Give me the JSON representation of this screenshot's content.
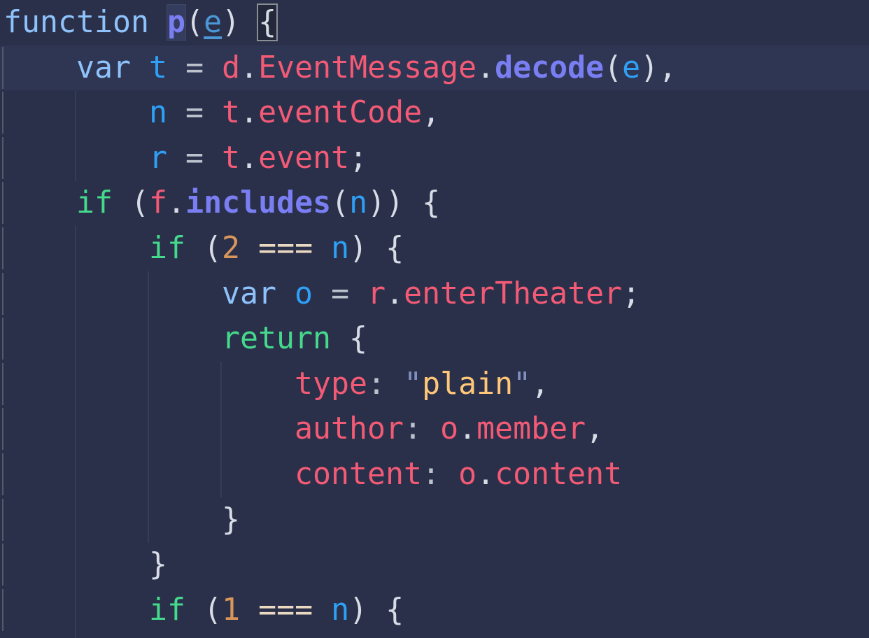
{
  "editor": {
    "colors": {
      "background": "#2a304a",
      "current_line": "#2f3653",
      "keyword": "#8ec2fb",
      "function": "#7a7ef3",
      "variable": "#2ea0f6",
      "property": "#f25a75",
      "control": "#45d98c",
      "number": "#d9965a",
      "string": "#ffc777"
    },
    "current_line_index": 1,
    "lines": [
      [
        [
          "function",
          "kw"
        ],
        [
          " ",
          "punc"
        ],
        [
          "p",
          "fn hl-p"
        ],
        [
          "(",
          "punc"
        ],
        [
          "e",
          "param"
        ],
        [
          ")",
          "punc"
        ],
        [
          " ",
          "punc"
        ],
        [
          "{",
          "punc hl-brace"
        ]
      ],
      [
        [
          "    ",
          "punc"
        ],
        [
          "var",
          "kw"
        ],
        [
          " ",
          "punc"
        ],
        [
          "t",
          "var"
        ],
        [
          " = ",
          "op"
        ],
        [
          "d",
          "prop"
        ],
        [
          ".",
          "punc"
        ],
        [
          "EventMessage",
          "prop"
        ],
        [
          ".",
          "punc"
        ],
        [
          "decode",
          "fn"
        ],
        [
          "(",
          "punc"
        ],
        [
          "e",
          "var"
        ],
        [
          "),",
          "punc"
        ]
      ],
      [
        [
          "        ",
          "punc"
        ],
        [
          "n",
          "var"
        ],
        [
          " = ",
          "op"
        ],
        [
          "t",
          "prop"
        ],
        [
          ".",
          "punc"
        ],
        [
          "eventCode",
          "prop"
        ],
        [
          ",",
          "punc"
        ]
      ],
      [
        [
          "        ",
          "punc"
        ],
        [
          "r",
          "var"
        ],
        [
          " = ",
          "op"
        ],
        [
          "t",
          "prop"
        ],
        [
          ".",
          "punc"
        ],
        [
          "event",
          "prop"
        ],
        [
          ";",
          "punc"
        ]
      ],
      [
        [
          "    ",
          "punc"
        ],
        [
          "if",
          "ctrl"
        ],
        [
          " (",
          "punc"
        ],
        [
          "f",
          "prop"
        ],
        [
          ".",
          "punc"
        ],
        [
          "includes",
          "fn"
        ],
        [
          "(",
          "punc"
        ],
        [
          "n",
          "var"
        ],
        [
          ")) {",
          "punc"
        ]
      ],
      [
        [
          "        ",
          "punc"
        ],
        [
          "if",
          "ctrl"
        ],
        [
          " (",
          "punc"
        ],
        [
          "2",
          "num"
        ],
        [
          " ",
          "punc"
        ],
        [
          "===",
          "cmp"
        ],
        [
          " ",
          "punc"
        ],
        [
          "n",
          "var"
        ],
        [
          ") {",
          "punc"
        ]
      ],
      [
        [
          "            ",
          "punc"
        ],
        [
          "var",
          "kw"
        ],
        [
          " ",
          "punc"
        ],
        [
          "o",
          "var"
        ],
        [
          " = ",
          "op"
        ],
        [
          "r",
          "prop"
        ],
        [
          ".",
          "punc"
        ],
        [
          "enterTheater",
          "prop"
        ],
        [
          ";",
          "punc"
        ]
      ],
      [
        [
          "            ",
          "punc"
        ],
        [
          "return",
          "ctrl"
        ],
        [
          " {",
          "punc"
        ]
      ],
      [
        [
          "                ",
          "punc"
        ],
        [
          "type",
          "prop"
        ],
        [
          ": ",
          "op"
        ],
        [
          "\"",
          "quote"
        ],
        [
          "plain",
          "str"
        ],
        [
          "\"",
          "quote"
        ],
        [
          ",",
          "punc"
        ]
      ],
      [
        [
          "                ",
          "punc"
        ],
        [
          "author",
          "prop"
        ],
        [
          ": ",
          "op"
        ],
        [
          "o",
          "prop"
        ],
        [
          ".",
          "punc"
        ],
        [
          "member",
          "prop"
        ],
        [
          ",",
          "punc"
        ]
      ],
      [
        [
          "                ",
          "punc"
        ],
        [
          "content",
          "prop"
        ],
        [
          ": ",
          "op"
        ],
        [
          "o",
          "prop"
        ],
        [
          ".",
          "punc"
        ],
        [
          "content",
          "prop"
        ]
      ],
      [
        [
          "            ",
          "punc"
        ],
        [
          "}",
          "punc"
        ]
      ],
      [
        [
          "        ",
          "punc"
        ],
        [
          "}",
          "punc"
        ]
      ],
      [
        [
          "        ",
          "punc"
        ],
        [
          "if",
          "ctrl"
        ],
        [
          " (",
          "punc"
        ],
        [
          "1",
          "num"
        ],
        [
          " ",
          "punc"
        ],
        [
          "===",
          "cmp"
        ],
        [
          " ",
          "punc"
        ],
        [
          "n",
          "var"
        ],
        [
          ") {",
          "punc"
        ]
      ]
    ]
  }
}
